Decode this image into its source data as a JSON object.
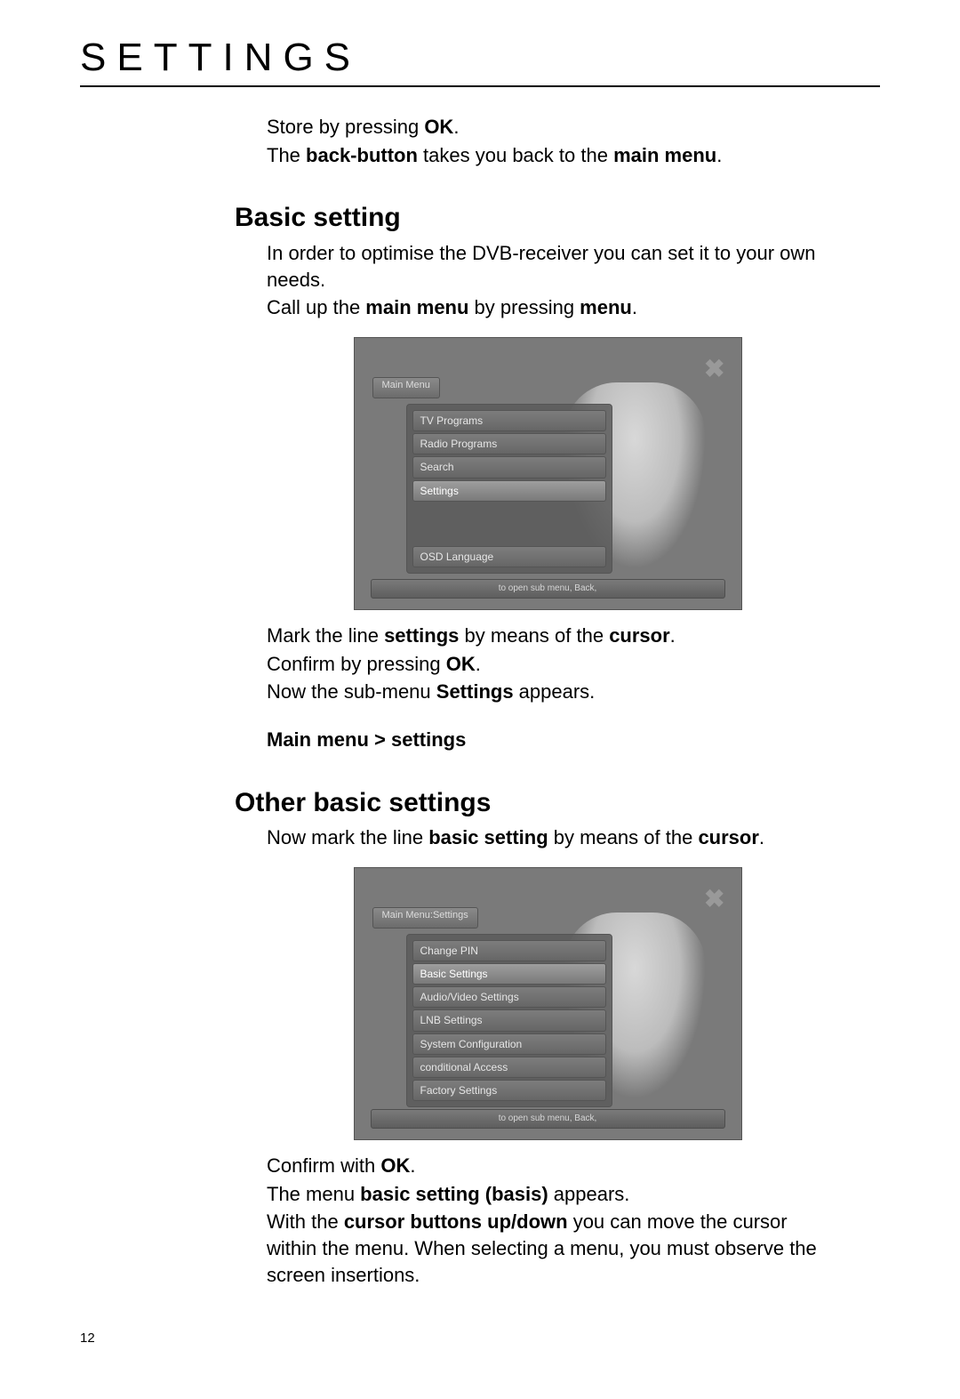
{
  "page_title": "SETTINGS",
  "page_number": "12",
  "intro": {
    "line1_pre": "Store by pressing ",
    "line1_bold": "OK",
    "line1_post": ".",
    "line2_pre": "The ",
    "line2_b1": "back-button",
    "line2_mid": " takes you back to the ",
    "line2_b2": "main menu",
    "line2_post": "."
  },
  "section1": {
    "heading": "Basic setting",
    "p1": "In order to optimise the DVB-receiver you can set it to your own needs.",
    "p2_pre": "Call up the  ",
    "p2_b1": "main menu",
    "p2_mid": " by pressing ",
    "p2_b2": "menu",
    "p2_post": ".",
    "after1_pre": "Mark the line ",
    "after1_b1": "settings",
    "after1_mid": " by means of the ",
    "after1_b2": "cursor",
    "after1_post": ".",
    "after2_pre": "Confirm by pressing ",
    "after2_b": "OK",
    "after2_post": ".",
    "after3_pre": "Now the sub-menu ",
    "after3_b": "Settings",
    "after3_post": " appears.",
    "breadcrumb": "Main menu > settings"
  },
  "shot1": {
    "crumb": "Main Menu",
    "items": [
      "TV Programs",
      "Radio Programs",
      "Search",
      "Settings",
      "OSD Language"
    ],
    "selected_index": 3,
    "has_gap_before_last": true,
    "footer": "to open sub menu,   Back,"
  },
  "section2": {
    "heading": "Other basic settings",
    "p1_pre": "Now mark the line ",
    "p1_b1": "basic setting",
    "p1_mid": " by means of the ",
    "p1_b2": "cursor",
    "p1_post": ".",
    "after1_pre": "Confirm with ",
    "after1_b": "OK",
    "after1_post": ".",
    "after2_pre": "The menu ",
    "after2_b": "basic setting (basis)",
    "after2_post": " appears.",
    "after3_pre": "With the ",
    "after3_b": "cursor buttons up/down",
    "after3_post": " you can move the cursor within the menu. When selecting a menu, you must observe the screen insertions."
  },
  "shot2": {
    "crumb": "Main Menu:Settings",
    "items": [
      "Change PIN",
      "Basic Settings",
      "Audio/Video Settings",
      "LNB Settings",
      "System Configuration",
      "conditional Access",
      "Factory Settings"
    ],
    "selected_index": 1,
    "footer": "to open sub menu,   Back,"
  }
}
